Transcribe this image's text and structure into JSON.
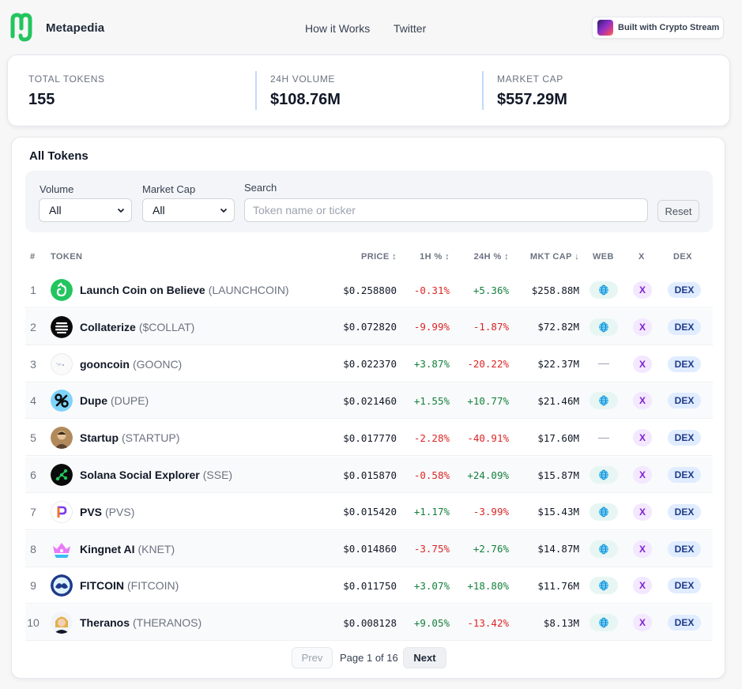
{
  "header": {
    "brand": "Metapedia",
    "brand_color": "#22c55e",
    "nav": [
      {
        "label": "How it Works"
      },
      {
        "label": "Twitter"
      }
    ],
    "built_with": "Built with Crypto Stream"
  },
  "stats": [
    {
      "label": "TOTAL TOKENS",
      "value": "155"
    },
    {
      "label": "24H VOLUME",
      "value": "$108.76M"
    },
    {
      "label": "MARKET CAP",
      "value": "$557.29M"
    }
  ],
  "tokens_section": {
    "title": "All Tokens",
    "filters": {
      "volume": {
        "label": "Volume",
        "value": "All"
      },
      "market_cap": {
        "label": "Market Cap",
        "value": "All"
      },
      "search": {
        "label": "Search",
        "placeholder": "Token name or ticker",
        "value": ""
      },
      "reset_label": "Reset"
    },
    "columns": {
      "num": "#",
      "token": "TOKEN",
      "price": "PRICE ↕",
      "h1": "1H % ↕",
      "h24": "24H % ↕",
      "mcap": "MKT CAP ↓",
      "web": "WEB",
      "x": "X",
      "dex": "DEX"
    },
    "rows": [
      {
        "num": "1",
        "name": "Launch Coin on Believe",
        "ticker": "(LAUNCHCOIN)",
        "price": "$0.258800",
        "h1": "-0.31%",
        "h24": "+5.36%",
        "mcap": "$258.88M",
        "web": true,
        "x": "X",
        "dex": "DEX",
        "icon": "launchcoin-icon"
      },
      {
        "num": "2",
        "name": "Collaterize",
        "ticker": "($COLLAT)",
        "price": "$0.072820",
        "h1": "-9.99%",
        "h24": "-1.87%",
        "mcap": "$72.82M",
        "web": true,
        "x": "X",
        "dex": "DEX",
        "icon": "collaterize-icon"
      },
      {
        "num": "3",
        "name": "gooncoin",
        "ticker": "(GOONC)",
        "price": "$0.022370",
        "h1": "+3.87%",
        "h24": "-20.22%",
        "mcap": "$22.37M",
        "web": false,
        "x": "X",
        "dex": "DEX",
        "icon": "gooncoin-icon"
      },
      {
        "num": "4",
        "name": "Dupe",
        "ticker": "(DUPE)",
        "price": "$0.021460",
        "h1": "+1.55%",
        "h24": "+10.77%",
        "mcap": "$21.46M",
        "web": true,
        "x": "X",
        "dex": "DEX",
        "icon": "dupe-icon"
      },
      {
        "num": "5",
        "name": "Startup",
        "ticker": "(STARTUP)",
        "price": "$0.017770",
        "h1": "-2.28%",
        "h24": "-40.91%",
        "mcap": "$17.60M",
        "web": false,
        "x": "X",
        "dex": "DEX",
        "icon": "startup-icon"
      },
      {
        "num": "6",
        "name": "Solana Social Explorer",
        "ticker": "(SSE)",
        "price": "$0.015870",
        "h1": "-0.58%",
        "h24": "+24.09%",
        "mcap": "$15.87M",
        "web": true,
        "x": "X",
        "dex": "DEX",
        "icon": "sse-icon"
      },
      {
        "num": "7",
        "name": "PVS",
        "ticker": "(PVS)",
        "price": "$0.015420",
        "h1": "+1.17%",
        "h24": "-3.99%",
        "mcap": "$15.43M",
        "web": true,
        "x": "X",
        "dex": "DEX",
        "icon": "pvs-icon"
      },
      {
        "num": "8",
        "name": "Kingnet AI",
        "ticker": "(KNET)",
        "price": "$0.014860",
        "h1": "-3.75%",
        "h24": "+2.76%",
        "mcap": "$14.87M",
        "web": true,
        "x": "X",
        "dex": "DEX",
        "icon": "kingnet-icon"
      },
      {
        "num": "9",
        "name": "FITCOIN",
        "ticker": "(FITCOIN)",
        "price": "$0.011750",
        "h1": "+3.07%",
        "h24": "+18.80%",
        "mcap": "$11.76M",
        "web": true,
        "x": "X",
        "dex": "DEX",
        "icon": "fitcoin-icon"
      },
      {
        "num": "10",
        "name": "Theranos",
        "ticker": "(THERANOS)",
        "price": "$0.008128",
        "h1": "+9.05%",
        "h24": "-13.42%",
        "mcap": "$8.13M",
        "web": true,
        "x": "X",
        "dex": "DEX",
        "icon": "theranos-icon"
      }
    ],
    "pagination": {
      "prev": "Prev",
      "info": "Page 1 of 16",
      "next": "Next"
    }
  }
}
